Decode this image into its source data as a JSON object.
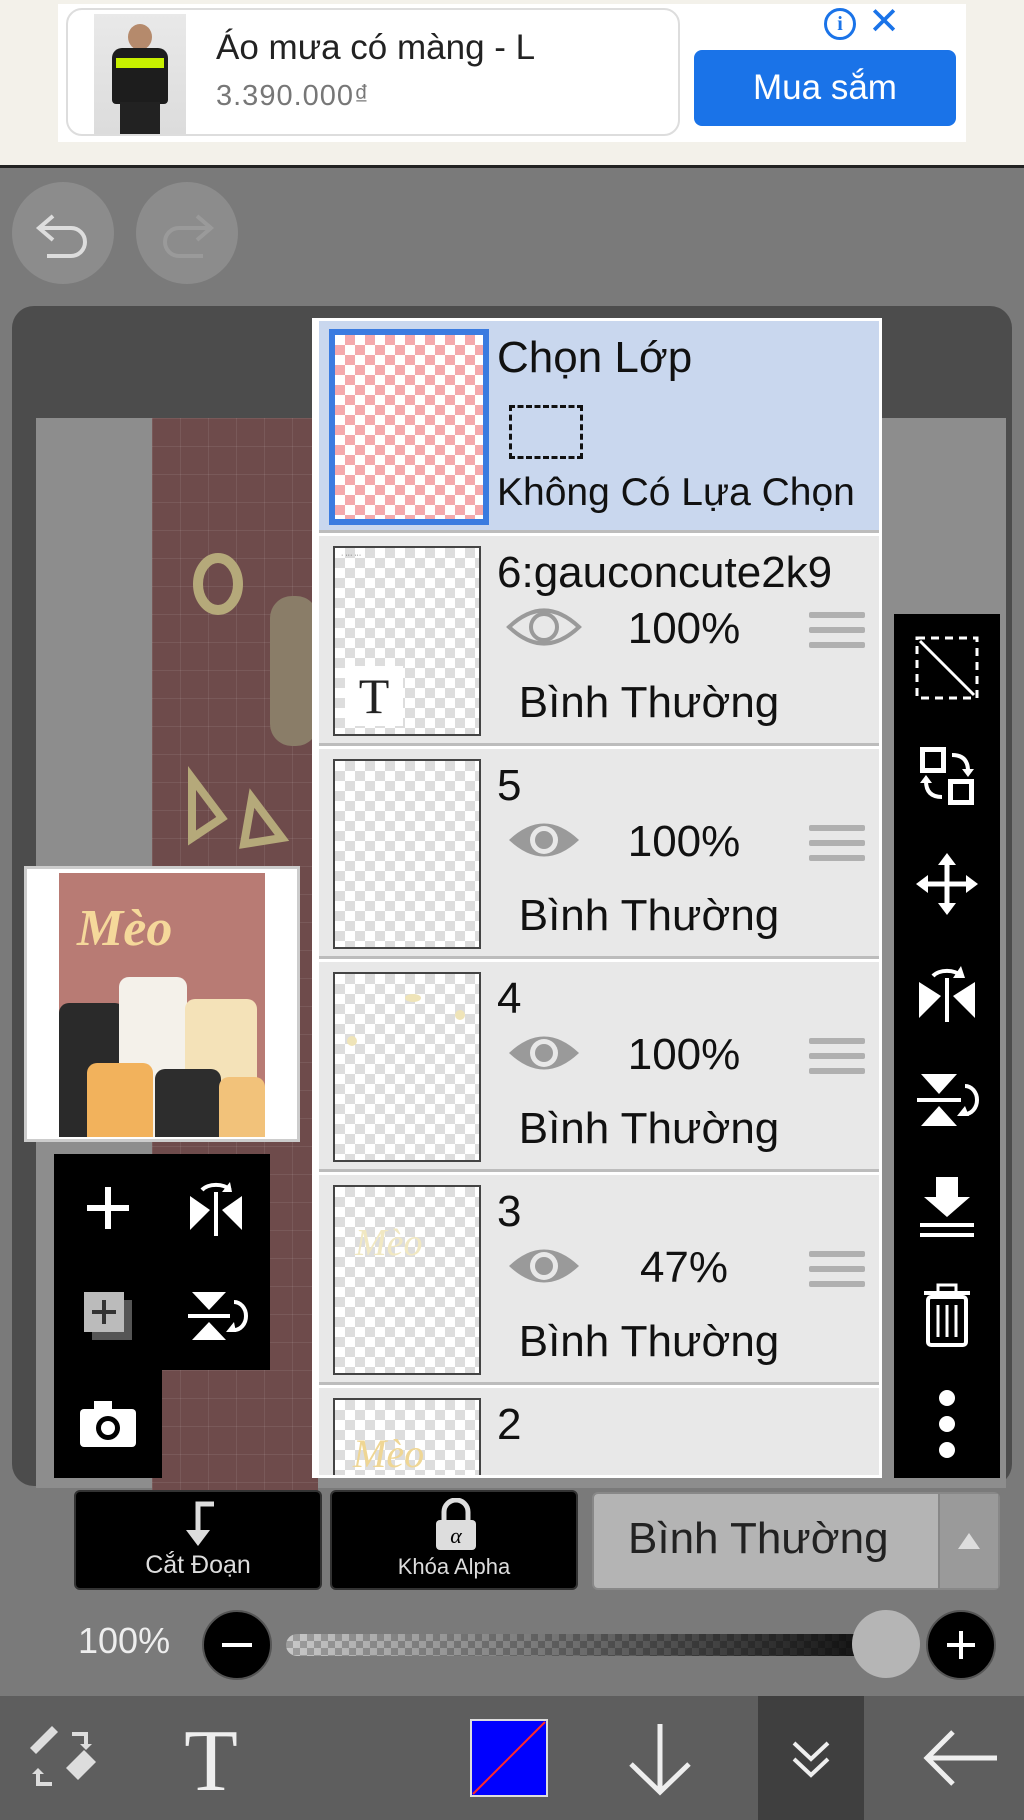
{
  "ad": {
    "title": "Áo mưa có màng - L",
    "price": "3.390.000₫",
    "buy_label": "Mua sắm",
    "info_icon": "i",
    "close_icon": "✕"
  },
  "layers_panel": {
    "selection_layer": {
      "title": "Chọn Lớp",
      "status": "Không Có Lựa Chọn"
    },
    "layers": [
      {
        "name": "6:gauconcute2k9",
        "opacity": "100%",
        "blend": "Bình Thường",
        "visible": true,
        "type": "text",
        "thumb_text": "T"
      },
      {
        "name": "5",
        "opacity": "100%",
        "blend": "Bình Thường",
        "visible": true
      },
      {
        "name": "4",
        "opacity": "100%",
        "blend": "Bình Thường",
        "visible": true
      },
      {
        "name": "3",
        "opacity": "47%",
        "blend": "Bình Thường",
        "visible": true
      },
      {
        "name": "2"
      }
    ]
  },
  "controls": {
    "clipping_label": "Cắt Đoạn",
    "alpha_lock_label": "Khóa Alpha",
    "blend_mode": "Bình Thường",
    "opacity_label": "100%",
    "opacity_value": 1.0
  },
  "preview": {
    "title": "Mèo"
  },
  "colors": {
    "primary_color": "#0000ff",
    "selection_highlight": "#c9d7ee",
    "accent_blue": "#1a73e8"
  }
}
